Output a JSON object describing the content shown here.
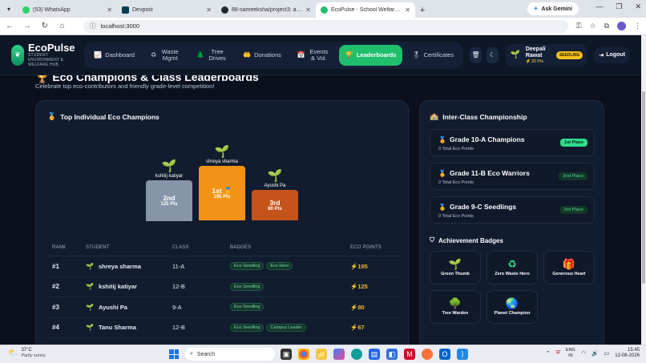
{
  "browser": {
    "tabs": [
      {
        "label": "(53) WhatsApp",
        "color": "#25d366",
        "active": false
      },
      {
        "label": "Devpost",
        "color": "#003e54",
        "active": false
      },
      {
        "label": "88-sameeksha/project3: antig...",
        "color": "#24292f",
        "active": false
      },
      {
        "label": "EcoPulse - School Welfare & En...",
        "color": "#1fbf6d",
        "active": true
      }
    ],
    "new_tab": "+",
    "gemini_label": "Ask Gemini",
    "url": "localhost:3000"
  },
  "app": {
    "logo": {
      "title": "EcoPulse",
      "subtitle": "STUDENT ENVIRONMENT & WELFARE HUB"
    },
    "nav": [
      {
        "label": "Dashboard",
        "icon": "chart-icon",
        "glyph": "📈",
        "active": false
      },
      {
        "label": "Waste Mgmt",
        "icon": "recycle-icon",
        "glyph": "♻",
        "active": false
      },
      {
        "label": "Tree Drives",
        "icon": "tree-icon",
        "glyph": "🌲",
        "active": false
      },
      {
        "label": "Donations",
        "icon": "donate-icon",
        "glyph": "🤲",
        "active": false
      },
      {
        "label": "Events & Vol.",
        "icon": "calendar-icon",
        "glyph": "📅",
        "active": false
      },
      {
        "label": "Leaderboards",
        "icon": "trophy-icon",
        "glyph": "🏆",
        "active": true
      },
      {
        "label": "Certificates",
        "icon": "certificate-icon",
        "glyph": "🎖",
        "active": false
      }
    ],
    "user": {
      "name": "Deepali Rawat",
      "points": "30 Pts",
      "level": "SEEDLING"
    },
    "logout_label": "Logout",
    "accent": "#1fbf6d"
  },
  "page": {
    "title": "Eco Champions & Class Leaderboards",
    "subtitle": "Celebrate top eco-contributors and friendly grade-level competition!"
  },
  "individual": {
    "title": "Top Individual Eco Champions",
    "podium": [
      {
        "name": "kshitij katiyar",
        "rank": "2nd",
        "points": "125 Pts",
        "color": "#8795a9"
      },
      {
        "name": "shreya sharma",
        "rank": "1st 🏅",
        "points": "195 Pts",
        "color": "#f39316"
      },
      {
        "name": "Ayushi Pa",
        "rank": "3rd",
        "points": "80 Pts",
        "color": "#c4541b"
      }
    ],
    "columns": [
      "RANK",
      "STUDENT",
      "CLASS",
      "BADGES",
      "ECO POINTS"
    ],
    "rows": [
      {
        "rank": "#1",
        "student": "shreya sharma",
        "class": "11-A",
        "badges": [
          "Eco Seedling",
          "Eco Hero"
        ],
        "points": "195"
      },
      {
        "rank": "#2",
        "student": "kshitij katiyar",
        "class": "12-B",
        "badges": [
          "Eco Seedling"
        ],
        "points": "125"
      },
      {
        "rank": "#3",
        "student": "Ayushi Pa",
        "class": "9-A",
        "badges": [
          "Eco Seedling"
        ],
        "points": "80"
      },
      {
        "rank": "#4",
        "student": "Tanu Sharma",
        "class": "12-B",
        "badges": [
          "Eco Seedling",
          "Campus Leader"
        ],
        "points": "67"
      }
    ]
  },
  "interclass": {
    "title": "Inter-Class Championship",
    "classes": [
      {
        "name": "Grade 10-A Champions",
        "points": "0 Total Eco Points",
        "place": "1st Place"
      },
      {
        "name": "Grade 11-B Eco Warriors",
        "points": "0 Total Eco Points",
        "place": "2nd Place"
      },
      {
        "name": "Grade 9-C Seedlings",
        "points": "0 Total Eco Points",
        "place": "3rd Place"
      }
    ]
  },
  "achievements": {
    "title": "Achievement Badges",
    "badges": [
      {
        "label": "Green Thumb",
        "icon": "sprout-icon",
        "glyph": "🌱"
      },
      {
        "label": "Zero Waste Hero",
        "icon": "recycle-icon",
        "glyph": "♻"
      },
      {
        "label": "Generous Heart",
        "icon": "gift-icon",
        "glyph": "🎁"
      },
      {
        "label": "Tree Warden",
        "icon": "tree-icon",
        "glyph": "🌳"
      },
      {
        "label": "Planet Champion",
        "icon": "globe-icon",
        "glyph": "🌏"
      }
    ]
  },
  "taskbar": {
    "weather_temp": "37°C",
    "weather_desc": "Partly sunny",
    "weather_badge": "1",
    "search_label": "Search",
    "lang_top": "ENG",
    "lang_bottom": "IN",
    "time": "15:45",
    "date": "12-08-2026"
  }
}
